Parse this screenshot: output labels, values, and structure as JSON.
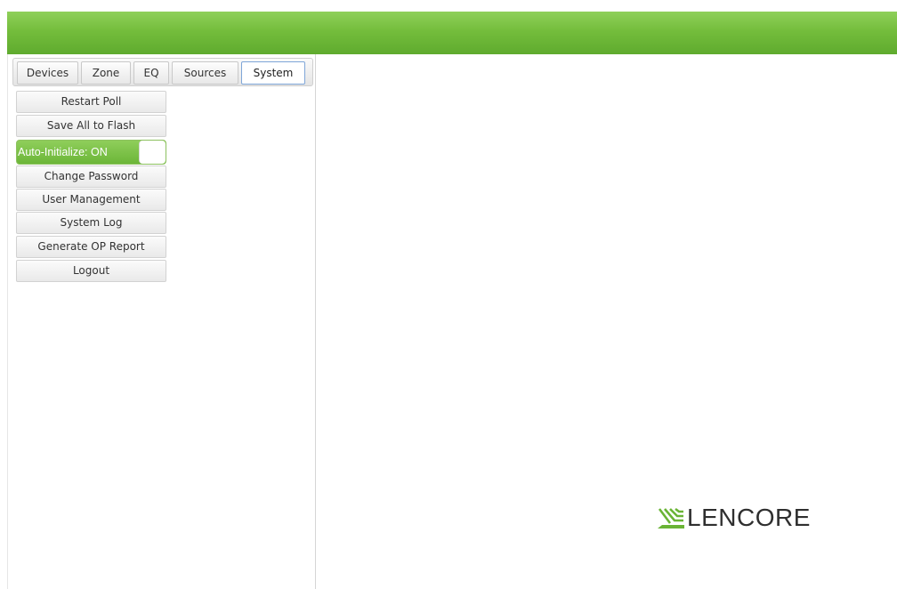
{
  "tabs": [
    {
      "label": "Devices"
    },
    {
      "label": "Zone"
    },
    {
      "label": "EQ"
    },
    {
      "label": "Sources"
    },
    {
      "label": "System"
    }
  ],
  "active_tab": "System",
  "system_menu": {
    "restart_poll": "Restart Poll",
    "save_all_to_flash": "Save All to Flash",
    "auto_initialize": {
      "label": "Auto-Initialize: ON",
      "state": "on"
    },
    "change_password": "Change Password",
    "user_management": "User Management",
    "system_log": "System Log",
    "generate_op_report": "Generate OP Report",
    "logout": "Logout"
  },
  "brand": {
    "logo_text": "LENCORE",
    "logo_icon": "lencore-wave-icon",
    "accent_color": "#74bd3c",
    "logo_mark_color": "#6ab435"
  }
}
